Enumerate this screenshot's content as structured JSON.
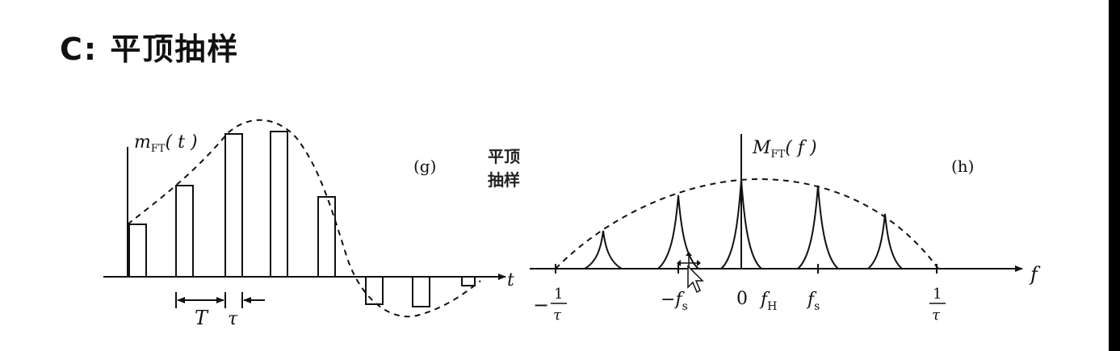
{
  "heading": {
    "prefix": "C:",
    "title": "平顶抽样"
  },
  "side_label": {
    "line1": "平顶",
    "line2": "抽样"
  },
  "left_plot": {
    "y_label_main": "m",
    "y_label_sub": "FT",
    "y_label_arg": "( t )",
    "panel_tag": "(g)",
    "x_axis_label": "t",
    "period_label": "T",
    "width_label": "τ"
  },
  "right_plot": {
    "y_label_main": "M",
    "y_label_sub": "FT",
    "y_label_arg": "( f )",
    "panel_tag": "(h)",
    "x_axis_label": "f",
    "tick_neg_inv_tau_sign": "−",
    "tick_inv_tau_num": "1",
    "tick_inv_tau_den": "τ",
    "tick_neg_fs_main": "−f",
    "tick_fs_main": "f",
    "tick_fs_sub": "s",
    "tick_zero": "0",
    "tick_fh_main": "f",
    "tick_fh_sub": "H"
  },
  "colors": {
    "ink": "#111111",
    "background": "#ffffff"
  },
  "icons": {
    "cursor": "arrow-move-cursor-icon"
  }
}
